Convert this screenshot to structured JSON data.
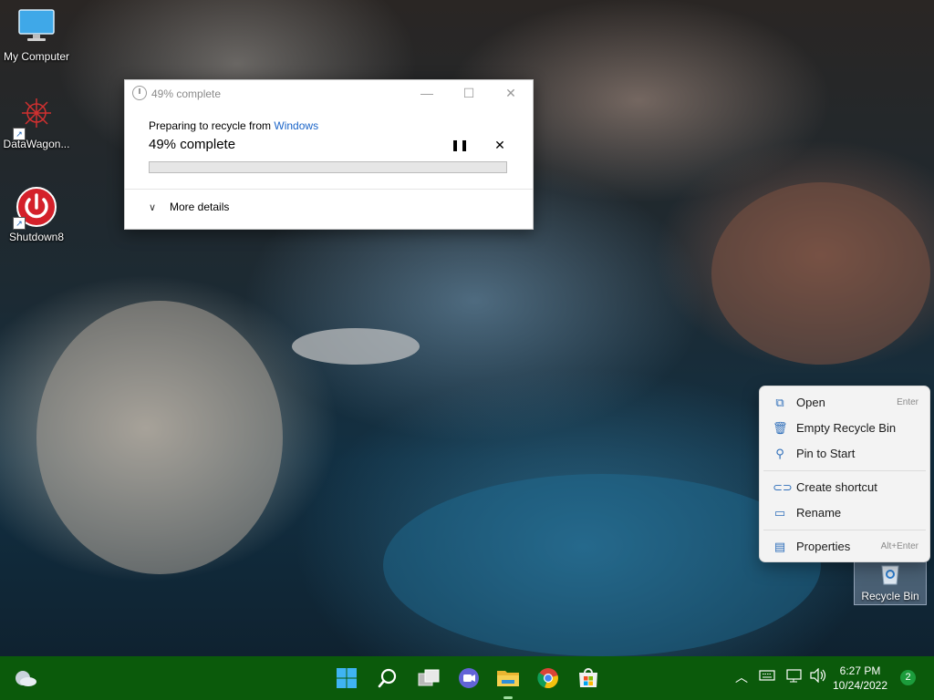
{
  "desktop": {
    "icons": [
      {
        "label": "My Computer"
      },
      {
        "label": "DataWagon..."
      },
      {
        "label": "Shutdown8"
      },
      {
        "label": "Recycle Bin"
      }
    ]
  },
  "dialog": {
    "title": "49% complete",
    "preparing_text": "Preparing to recycle from ",
    "source_link": "Windows",
    "percent_text": "49% complete",
    "progress_fraction": 0.0,
    "more_details": "More details"
  },
  "context_menu": {
    "items": [
      {
        "label": "Open",
        "accelerator": "Enter",
        "icon": "open-icon"
      },
      {
        "label": "Empty Recycle Bin",
        "accelerator": "",
        "icon": "recycle-bin-icon"
      },
      {
        "label": "Pin to Start",
        "accelerator": "",
        "icon": "pin-icon"
      },
      {
        "label": "Create shortcut",
        "accelerator": "",
        "icon": "link-icon"
      },
      {
        "label": "Rename",
        "accelerator": "",
        "icon": "rename-icon"
      },
      {
        "label": "Properties",
        "accelerator": "Alt+Enter",
        "icon": "properties-icon"
      }
    ]
  },
  "taskbar": {
    "clock_time": "6:27 PM",
    "clock_date": "10/24/2022",
    "notification_count": "2",
    "apps": [
      "start-icon",
      "search-icon",
      "task-view-icon",
      "teams-chat-icon",
      "file-explorer-icon",
      "chrome-icon",
      "store-icon"
    ]
  },
  "colors": {
    "taskbar": "#0b5a0b",
    "accent_link": "#1a64c8",
    "progress_fill": "#06b025"
  }
}
